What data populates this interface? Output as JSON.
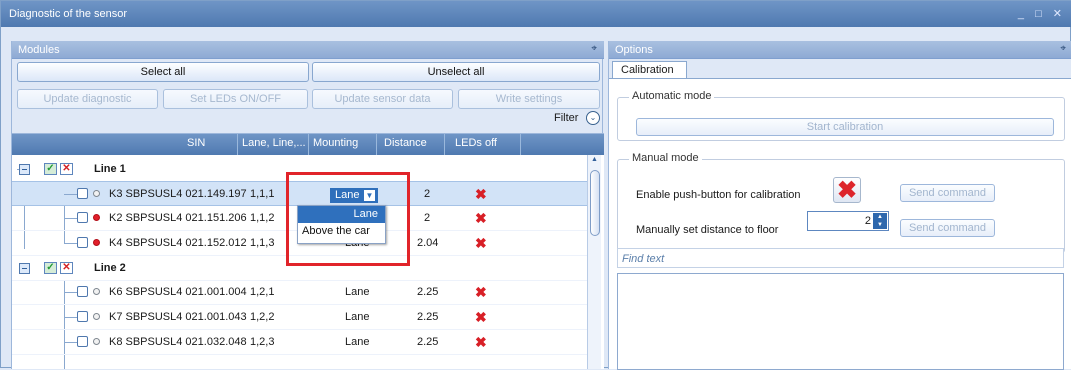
{
  "window": {
    "title": "Diagnostic of the sensor"
  },
  "modules": {
    "title": "Modules",
    "buttons": {
      "select_all": "Select all",
      "unselect_all": "Unselect all",
      "update_diagnostic": "Update diagnostic",
      "set_leds": "Set LEDs ON/OFF",
      "update_sensor_data": "Update sensor data",
      "write_settings": "Write settings",
      "filter": "Filter"
    },
    "columns": [
      "SIN",
      "Lane, Line,...",
      "Mounting",
      "Distance",
      "LEDs off"
    ],
    "groups": [
      {
        "name": "Line 1",
        "rows": [
          {
            "sin": "K3 SBPSUSL4 021.149.197",
            "lane": "1,1,1",
            "mounting": "Lane",
            "distance": "2",
            "status": "grey"
          },
          {
            "sin": "K2 SBPSUSL4 021.151.206",
            "lane": "1,1,2",
            "mounting": "",
            "distance": "2",
            "status": "red"
          },
          {
            "sin": "K4 SBPSUSL4 021.152.012",
            "lane": "1,1,3",
            "mounting": "Lane",
            "distance": "2.04",
            "status": "red"
          }
        ]
      },
      {
        "name": "Line 2",
        "rows": [
          {
            "sin": "K6 SBPSUSL4 021.001.004",
            "lane": "1,2,1",
            "mounting": "Lane",
            "distance": "2.25",
            "status": "grey"
          },
          {
            "sin": "K7 SBPSUSL4 021.001.043",
            "lane": "1,2,2",
            "mounting": "Lane",
            "distance": "2.25",
            "status": "grey"
          },
          {
            "sin": "K8 SBPSUSL4 021.032.048",
            "lane": "1,2,3",
            "mounting": "Lane",
            "distance": "2.25",
            "status": "grey"
          }
        ]
      }
    ],
    "dropdown": {
      "selected": "Lane",
      "options": [
        "Lane",
        "Above the car"
      ]
    }
  },
  "options": {
    "title": "Options",
    "tab": "Calibration",
    "automatic": {
      "legend": "Automatic mode",
      "button": "Start calibration"
    },
    "manual": {
      "legend": "Manual mode",
      "push_label": "Enable push-button for calibration",
      "distance_label": "Manually set distance to floor",
      "distance_value": "2",
      "send_command": "Send command"
    },
    "find_text": "Find text"
  },
  "colors": {
    "accent": "#4f79b0",
    "selection": "#d2e3f7",
    "error": "#d81f26",
    "highlight": "#e1242a"
  }
}
